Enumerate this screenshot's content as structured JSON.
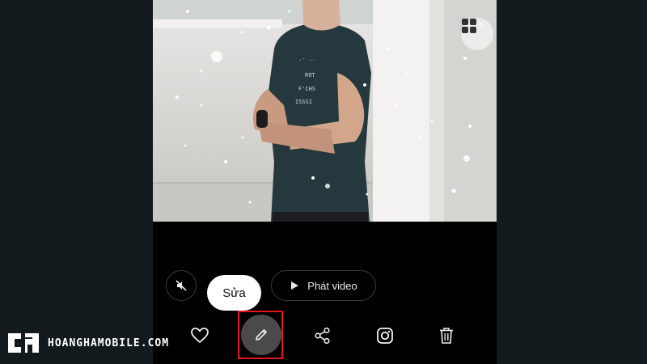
{
  "photo": {
    "description_icon": "gallery-grid-icon"
  },
  "controls": {
    "mute_icon": "speaker-muted-icon",
    "edit_tooltip": "Sửa",
    "play_icon": "play-icon",
    "play_label": "Phát video"
  },
  "toolbar": {
    "icons": [
      "heart-icon",
      "pencil-icon",
      "share-icon",
      "instagram-icon",
      "trash-icon"
    ]
  },
  "brand": {
    "name": "HOANGHAMOBILE.COM"
  },
  "colors": {
    "page_bg": "#121a1e",
    "screen_bg": "#000000",
    "highlight": "#e2161b",
    "edit_button_bg": "#4a4a4a"
  }
}
